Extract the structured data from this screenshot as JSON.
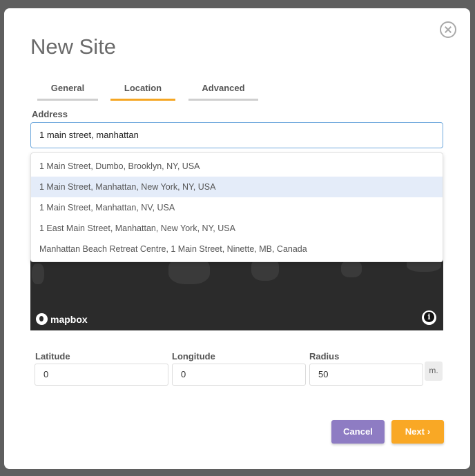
{
  "dialog": {
    "title": "New Site"
  },
  "tabs": [
    {
      "label": "General",
      "active": false
    },
    {
      "label": "Location",
      "active": true
    },
    {
      "label": "Advanced",
      "active": false
    }
  ],
  "address": {
    "label": "Address",
    "value": "1 main street, manhattan"
  },
  "suggestions": [
    "1 Main Street, Dumbo, Brooklyn, NY, USA",
    "1 Main Street, Manhattan, New York, NY, USA",
    "1 Main Street, Manhattan, NV, USA",
    "1 East Main Street, Manhattan, New York, NY, USA",
    "Manhattan Beach Retreat Centre, 1 Main Street, Ninette, MB, Canada"
  ],
  "highlighted_suggestion_index": 1,
  "map": {
    "attribution_logo_text": "mapbox",
    "info_icon": "info-icon"
  },
  "fields": {
    "latitude": {
      "label": "Latitude",
      "value": "0"
    },
    "longitude": {
      "label": "Longitude",
      "value": "0"
    },
    "radius": {
      "label": "Radius",
      "value": "50",
      "unit": "m."
    }
  },
  "buttons": {
    "cancel_label": "Cancel",
    "next_label": "Next",
    "next_icon": "chevron-right-icon"
  },
  "colors": {
    "accent_tab": "#f5a623",
    "cancel_button": "#8e7cc3",
    "next_button": "#f9a825",
    "highlight_row": "#e4ecf9",
    "input_focus_border": "#6ea8dc"
  }
}
